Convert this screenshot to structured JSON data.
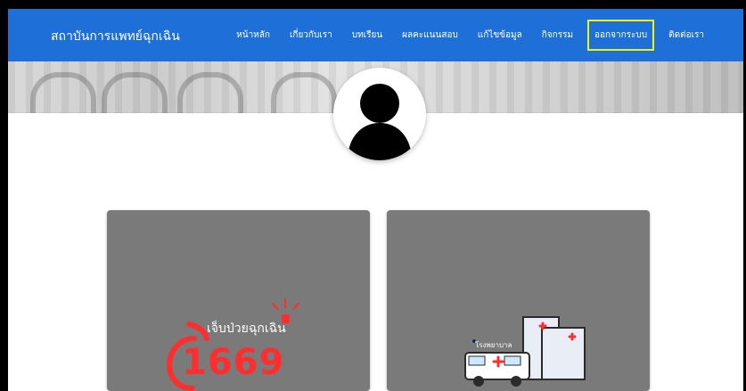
{
  "app": {
    "brand": "สถาบันการแพทย์ฉุกเฉิน"
  },
  "nav": {
    "items": [
      "หน้าหลัก",
      "เกี่ยวกับเรา",
      "บทเรียน",
      "ผลคะแนนสอบ",
      "แก้ไขข้อมูล",
      "กิจกรรม",
      "ออกจากระบบ",
      "ติดต่อเรา"
    ],
    "highlighted_index": 6
  },
  "cards": [
    {
      "title": "เจ็บป่วยฉุกเฉิน",
      "number": "1669"
    },
    {
      "label": "โรงพยาบาล"
    }
  ],
  "colors": {
    "navbar": "#1e6fd8",
    "highlight": "#f2f20a",
    "card_bg": "#7a7a7a",
    "emergency_red": "#ff2d2d"
  }
}
